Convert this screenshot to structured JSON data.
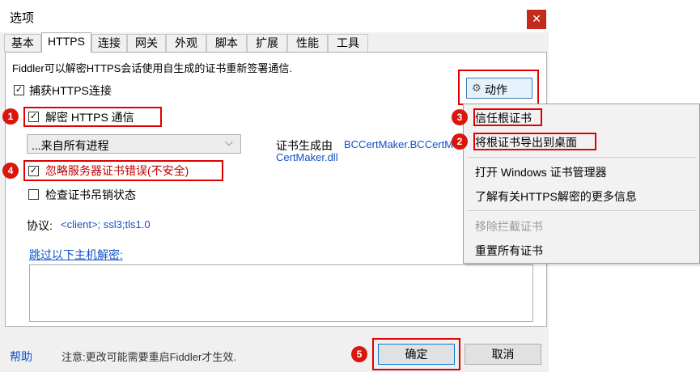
{
  "dialog": {
    "title": "选项",
    "close_glyph": "✕"
  },
  "tabs": [
    "基本",
    "HTTPS",
    "连接",
    "网关",
    "外观",
    "脚本",
    "扩展",
    "性能",
    "工具"
  ],
  "https": {
    "description": "Fiddler可以解密HTTPS会话使用自生成的证书重新签署通信.",
    "capture_label": "捕获HTTPS连接",
    "capture_checked": true,
    "decrypt_label": "解密 HTTPS 通信",
    "decrypt_checked": true,
    "process_select_value": "...来自所有进程",
    "cert_gen_label": "证书生成由",
    "cert_gen_value_1": "BCCertMaker.BCCertM",
    "cert_gen_value_2": "CertMaker.dll",
    "ignore_errors_label": "忽略服务器证书错误(不安全)",
    "ignore_errors_checked": true,
    "check_revocation_label": "检查证书吊销状态",
    "check_revocation_checked": false,
    "protocols_label": "协议:",
    "protocols_value": "<client>; ssl3;tls1.0",
    "skip_hosts_link": "跳过以下主机解密:",
    "skip_hosts_value": "",
    "actions_button": "动作"
  },
  "actions_menu": {
    "items": [
      "信任根证书",
      "将根证书导出到桌面",
      "打开 Windows 证书管理器",
      "了解有关HTTPS解密的更多信息",
      "移除拦截证书",
      "重置所有证书"
    ],
    "disabled_index": 4
  },
  "footer": {
    "help_link": "帮助",
    "note": "注意:更改可能需要重启Fiddler才生效.",
    "ok_button": "确定",
    "cancel_button": "取消"
  },
  "badges": [
    "1",
    "2",
    "3",
    "4",
    "5"
  ],
  "colors": {
    "highlight_red": "#e00000",
    "badge_red": "#d8160e",
    "link_blue": "#1050c8",
    "warning_text": "#c00000"
  },
  "icons": {
    "checkbox_check": "✓",
    "dropdown_arrow": "⌵",
    "action_icon": "gear-icon"
  }
}
